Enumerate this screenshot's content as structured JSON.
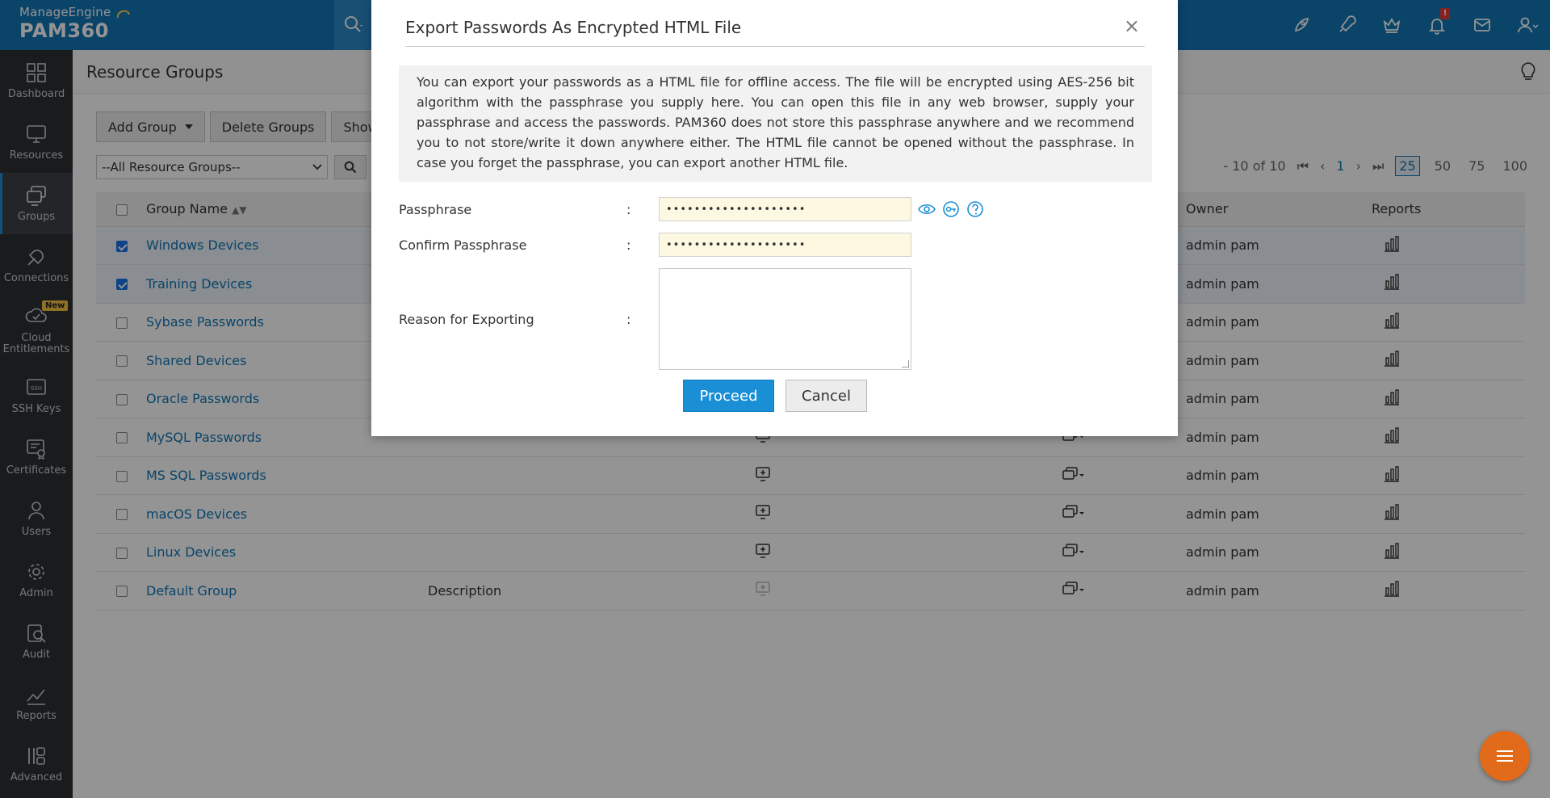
{
  "app": {
    "brand_sub": "ManageEngine",
    "brand_main": "PAM360"
  },
  "colors": {
    "topbar": "#1276b5",
    "sidebar": "#2c2f33",
    "accent": "#1a8fd6",
    "link": "#1276b5",
    "fab": "#e26a1b"
  },
  "topbar": {
    "notification_count": "!"
  },
  "sidebar": {
    "items": [
      {
        "label": "Dashboard",
        "icon": "dashboard-icon"
      },
      {
        "label": "Resources",
        "icon": "monitor-icon"
      },
      {
        "label": "Groups",
        "icon": "groups-icon",
        "active": true
      },
      {
        "label": "Connections",
        "icon": "connections-icon"
      },
      {
        "label": "Cloud Entitlements",
        "icon": "cloud-entitlements-icon",
        "badge": "New"
      },
      {
        "label": "SSH Keys",
        "icon": "ssh-keys-icon"
      },
      {
        "label": "Certificates",
        "icon": "certificate-icon"
      },
      {
        "label": "Users",
        "icon": "user-icon"
      },
      {
        "label": "Admin",
        "icon": "gear-icon"
      },
      {
        "label": "Audit",
        "icon": "audit-icon"
      },
      {
        "label": "Reports",
        "icon": "reports-icon"
      },
      {
        "label": "Advanced",
        "icon": "advanced-icon"
      }
    ]
  },
  "page": {
    "title": "Resource Groups",
    "toolbar": {
      "add_group": "Add Group",
      "delete_groups": "Delete Groups",
      "show": "Show"
    },
    "filter": {
      "selected": "--All Resource Groups--"
    },
    "pager": {
      "range": "- 10 of 10",
      "page": "1",
      "sizes": [
        "25",
        "50",
        "75",
        "100"
      ],
      "selected_size": "25"
    },
    "table": {
      "headers": {
        "group_name": "Group Name",
        "owner": "Owner",
        "reports": "Reports"
      },
      "rows": [
        {
          "name": "Windows Devices",
          "description": "",
          "owner": "admin pam",
          "checked": true
        },
        {
          "name": "Training Devices",
          "description": "",
          "owner": "admin pam",
          "checked": true
        },
        {
          "name": "Sybase Passwords",
          "description": "",
          "owner": "admin pam",
          "checked": false
        },
        {
          "name": "Shared Devices",
          "description": "",
          "owner": "admin pam",
          "checked": false
        },
        {
          "name": "Oracle Passwords",
          "description": "",
          "owner": "admin pam",
          "checked": false
        },
        {
          "name": "MySQL Passwords",
          "description": "",
          "owner": "admin pam",
          "checked": false
        },
        {
          "name": "MS SQL Passwords",
          "description": "",
          "owner": "admin pam",
          "checked": false
        },
        {
          "name": "macOS Devices",
          "description": "",
          "owner": "admin pam",
          "checked": false
        },
        {
          "name": "Linux Devices",
          "description": "",
          "owner": "admin pam",
          "checked": false
        },
        {
          "name": "Default Group",
          "description": "Description",
          "owner": "admin pam",
          "checked": false
        }
      ]
    }
  },
  "dialog": {
    "title": "Export Passwords As Encrypted HTML File",
    "close": "×",
    "info": "You can export your passwords as a HTML file for offline access. The file will be encrypted using AES-256 bit algorithm with the passphrase you supply here. You can open this file in any web browser, supply your passphrase and access the passwords. PAM360 does not store this passphrase anywhere and we recommend you to not store/write it down anywhere either. The HTML file cannot be opened without the passphrase. In case you forget the passphrase, you can export another HTML file.",
    "passphrase_label": "Passphrase",
    "passphrase_value": "••••••••••••••••••••",
    "confirm_label": "Confirm Passphrase",
    "confirm_value": "••••••••••••••••••••",
    "reason_label": "Reason for Exporting",
    "reason_value": "",
    "colon": ":",
    "proceed": "Proceed",
    "cancel": "Cancel"
  }
}
